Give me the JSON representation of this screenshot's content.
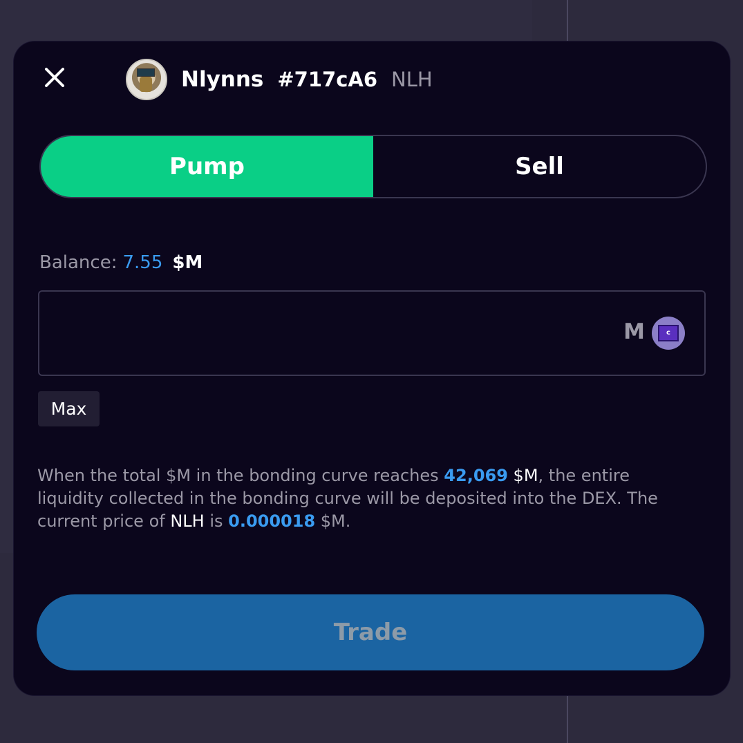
{
  "header": {
    "close_icon": "close-icon",
    "token_name": "Nlynns",
    "token_id": "#717cA6",
    "token_symbol": "NLH"
  },
  "toggle": {
    "pump_label": "Pump",
    "sell_label": "Sell",
    "active": "Pump"
  },
  "balance": {
    "label": "Balance:",
    "value": "7.55",
    "unit": "$M"
  },
  "amount": {
    "value": "",
    "placeholder": "",
    "currency_letter": "M",
    "currency_icon": "castle-coin-icon"
  },
  "max_label": "Max",
  "info": {
    "part1": "When the total $M in the bonding curve reaches ",
    "threshold": "42,069",
    "threshold_unit": " $M",
    "part2": ", the entire liquidity collected in the bonding curve will be deposited into the DEX. The current price of ",
    "symbol": "NLH",
    "part3": " is ",
    "price": "0.000018",
    "part4": " $M."
  },
  "trade_label": "Trade",
  "colors": {
    "pump_active": "#0acf86",
    "accent_blue": "#3a9bf0",
    "trade_button": "#1b64a2",
    "modal_bg": "#0b061c"
  }
}
